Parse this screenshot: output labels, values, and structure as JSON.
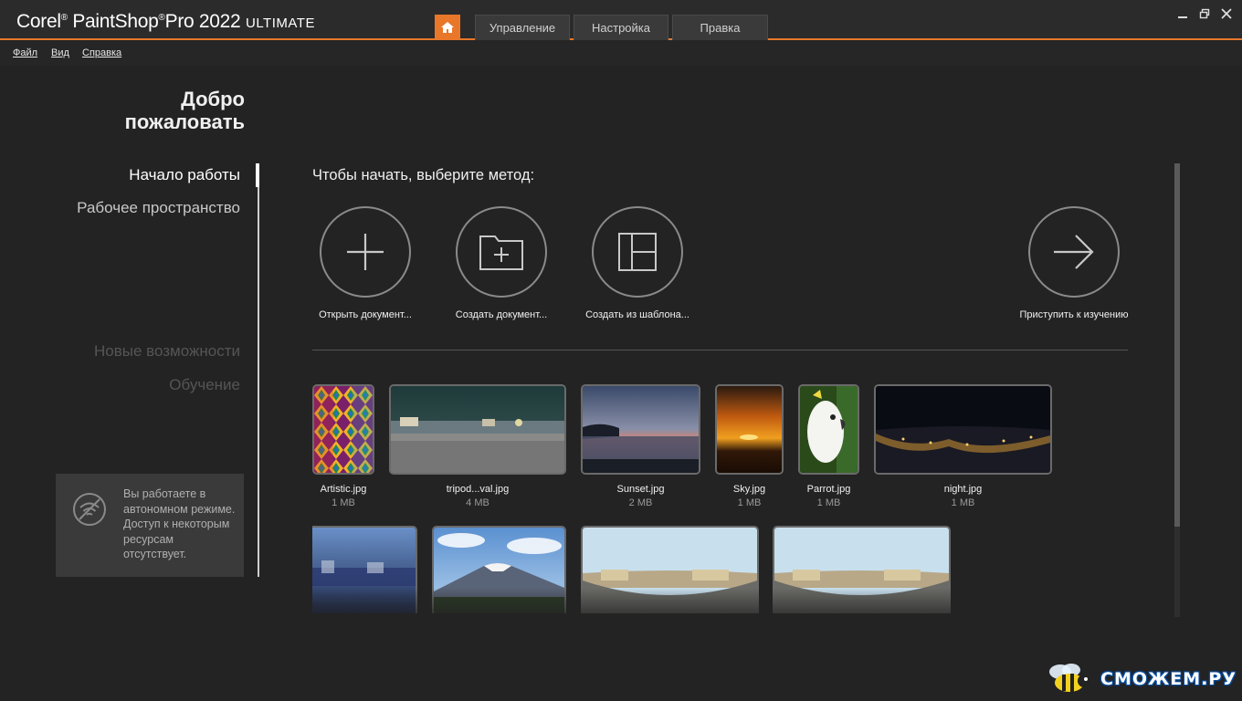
{
  "window": {
    "title_brand": "Corel",
    "title_product": "PaintShop",
    "title_pro": "Pro 2022",
    "title_edition": "ULTIMATE",
    "tabs": [
      {
        "label": "Управление"
      },
      {
        "label": "Настройка"
      },
      {
        "label": "Правка"
      }
    ],
    "accent_color": "#e8772a"
  },
  "menu": {
    "items": [
      {
        "label": "Файл"
      },
      {
        "label": "Вид"
      },
      {
        "label": "Справка"
      }
    ]
  },
  "sidebar": {
    "welcome_line1": "Добро",
    "welcome_line2": "пожаловать",
    "items": [
      {
        "label": "Начало работы",
        "state": "active"
      },
      {
        "label": "Рабочее пространство",
        "state": "normal"
      },
      {
        "label": "Новые возможности",
        "state": "disabled"
      },
      {
        "label": "Обучение",
        "state": "disabled"
      }
    ],
    "offline_notice": "Вы работаете в автономном режиме. Доступ к некоторым ресурсам отсутствует."
  },
  "main": {
    "prompt": "Чтобы начать, выберите метод:",
    "actions": [
      {
        "label": "Открыть документ...",
        "icon": "plus-icon"
      },
      {
        "label": "Создать документ...",
        "icon": "new-folder-icon"
      },
      {
        "label": "Создать из шаблона...",
        "icon": "template-icon"
      },
      {
        "label": "Приступить к изучению",
        "icon": "arrow-right-icon"
      }
    ],
    "recent_files": [
      {
        "name": "Artistic.jpg",
        "size": "1 MB"
      },
      {
        "name": "tripod...val.jpg",
        "size": "4 MB"
      },
      {
        "name": "Sunset.jpg",
        "size": "2 MB"
      },
      {
        "name": "Sky.jpg",
        "size": "1 MB"
      },
      {
        "name": "Parrot.jpg",
        "size": "1 MB"
      },
      {
        "name": "night.jpg",
        "size": "1 MB"
      }
    ]
  },
  "watermark": {
    "text": "СМОЖЕМ.РУ"
  }
}
